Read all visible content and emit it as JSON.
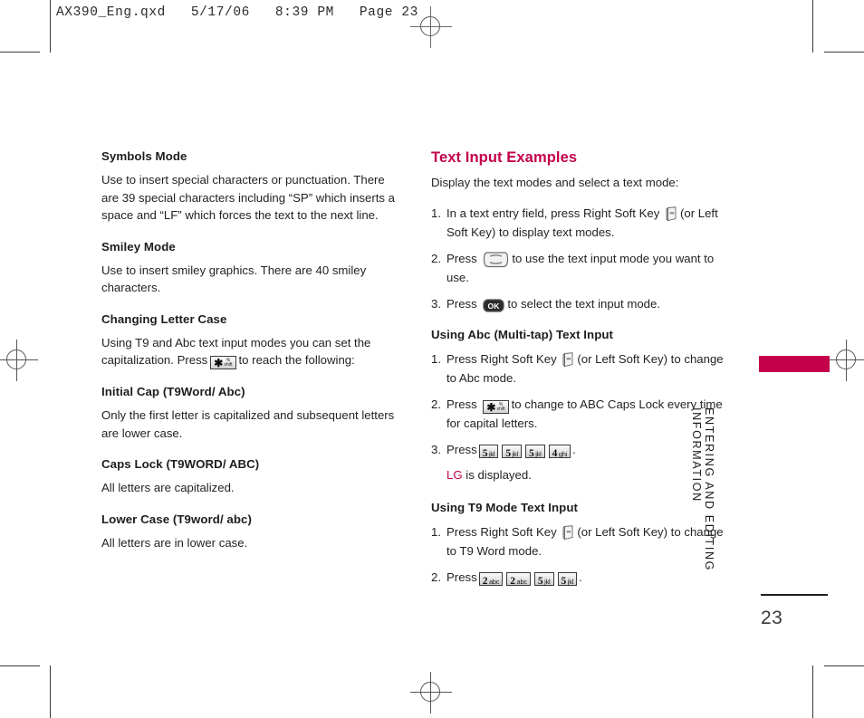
{
  "prepress": {
    "header": "AX390_Eng.qxd   5/17/06   8:39 PM   Page 23",
    "registration_icon": "registration-target-icon"
  },
  "left_column": {
    "blocks": [
      {
        "heading": "Symbols Mode",
        "text": "Use to insert special characters or punctuation. There are 39 special characters including “SP” which inserts a space and “LF” which forces the text to the next line."
      },
      {
        "heading": "Smiley Mode",
        "text": "Use to insert smiley graphics. There are 40 smiley characters."
      },
      {
        "heading": "Changing Letter Case",
        "text_before_key": "Using T9 and Abc text input modes you can set the capitalization. Press",
        "text_after_key": "to reach the following:",
        "key": {
          "type": "star-key",
          "glyph": "✱",
          "shift_top": "%",
          "shift_bottom": "shift"
        }
      },
      {
        "heading": "Initial Cap (T9Word/ Abc)",
        "text": "Only the first letter is capitalized and subsequent letters are lower case."
      },
      {
        "heading": "Caps Lock (T9WORD/ ABC)",
        "text": "All letters are capitalized."
      },
      {
        "heading": "Lower Case (T9word/ abc)",
        "text": "All letters are in lower case."
      }
    ]
  },
  "right_column": {
    "title": "Text Input Examples",
    "title_color": "#c4004b",
    "intro": "Display the text modes and select a text mode:",
    "steps_main": [
      {
        "parts": [
          "In a text entry field, press Right Soft Key"
        ],
        "icon": "soft-key-icon",
        "tail": "(or Left  Soft Key) to display text modes."
      },
      {
        "parts": [
          "Press"
        ],
        "icon": "navigation-key-icon",
        "tail": "to use the text input mode you want to use."
      },
      {
        "parts": [
          "Press"
        ],
        "icon": "ok-key-icon",
        "icon_label": "OK",
        "tail": "to select the text input mode."
      }
    ],
    "section_abc": {
      "heading": "Using Abc (Multi-tap) Text Input",
      "steps": [
        {
          "lead": "Press Right Soft Key",
          "icon": "soft-key-icon",
          "tail": "(or Left Soft Key) to change to Abc mode."
        },
        {
          "lead": "Press",
          "icon": "star-key-icon",
          "tail": "to change to ABC Caps Lock every time for capital letters."
        },
        {
          "lead": "Press",
          "keys": [
            {
              "digit": "5",
              "letters": "jkl"
            },
            {
              "digit": "5",
              "letters": "jkl"
            },
            {
              "digit": "5",
              "letters": "jkl"
            },
            {
              "digit": "4",
              "letters": "ghi"
            }
          ],
          "tail": ".",
          "result_prefix": "LG",
          "result_suffix": "is displayed."
        }
      ]
    },
    "section_t9": {
      "heading": "Using T9 Mode Text Input",
      "steps": [
        {
          "lead": "Press Right Soft Key",
          "icon": "soft-key-icon",
          "tail": "(or Left Soft Key) to change to T9 Word mode."
        },
        {
          "lead": "Press",
          "keys": [
            {
              "digit": "2",
              "letters": "abc"
            },
            {
              "digit": "2",
              "letters": "abc"
            },
            {
              "digit": "5",
              "letters": "jkl"
            },
            {
              "digit": "5",
              "letters": "jkl"
            }
          ],
          "tail": "."
        }
      ]
    }
  },
  "side_tab": {
    "color": "#c4004b",
    "label_line1": "ENTERING  AND  EDITING",
    "label_line2": "INFORMATION",
    "page_number": "23"
  }
}
